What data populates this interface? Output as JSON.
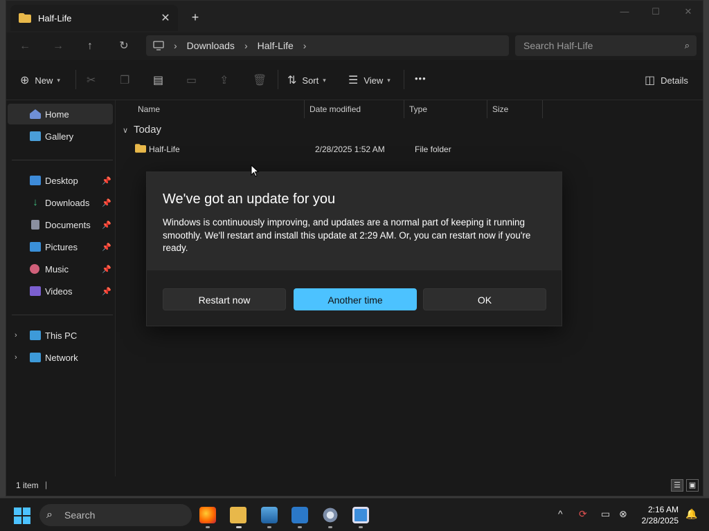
{
  "window": {
    "tab_title": "Half-Life",
    "tab_close": "✕",
    "tab_add": "+",
    "controls": {
      "minimize": "—",
      "maximize": "☐",
      "close": "✕"
    }
  },
  "navbar": {
    "breadcrumb": [
      "Downloads",
      "Half-Life"
    ],
    "search_placeholder": "Search Half-Life"
  },
  "toolbar": {
    "new_label": "New",
    "sort_label": "Sort",
    "view_label": "View",
    "more_label": "•••",
    "details_label": "Details"
  },
  "sidebar": {
    "top": [
      {
        "label": "Home"
      },
      {
        "label": "Gallery"
      }
    ],
    "pinned": [
      {
        "label": "Desktop"
      },
      {
        "label": "Downloads"
      },
      {
        "label": "Documents"
      },
      {
        "label": "Pictures"
      },
      {
        "label": "Music"
      },
      {
        "label": "Videos"
      }
    ],
    "bottom": [
      {
        "label": "This PC"
      },
      {
        "label": "Network"
      }
    ]
  },
  "content": {
    "columns": [
      "Name",
      "Date modified",
      "Type",
      "Size"
    ],
    "group": "Today",
    "rows": [
      {
        "name": "Half-Life",
        "date": "2/28/2025 1:52 AM",
        "type": "File folder",
        "size": ""
      }
    ]
  },
  "statusbar": {
    "count": "1 item"
  },
  "dialog": {
    "title": "We've got an update for you",
    "body": "Windows is continuously improving, and updates are a normal part of keeping it running smoothly. We'll restart and install this update at 2:29 AM. Or, you can restart now if you're ready.",
    "buttons": [
      "Restart now",
      "Another time",
      "OK"
    ]
  },
  "taskbar": {
    "search_placeholder": "Search",
    "time": "2:16 AM",
    "date": "2/28/2025"
  },
  "colors": {
    "accent": "#4cc2ff",
    "window_bg": "#191919",
    "dialog_bg": "#2b2b2b"
  }
}
